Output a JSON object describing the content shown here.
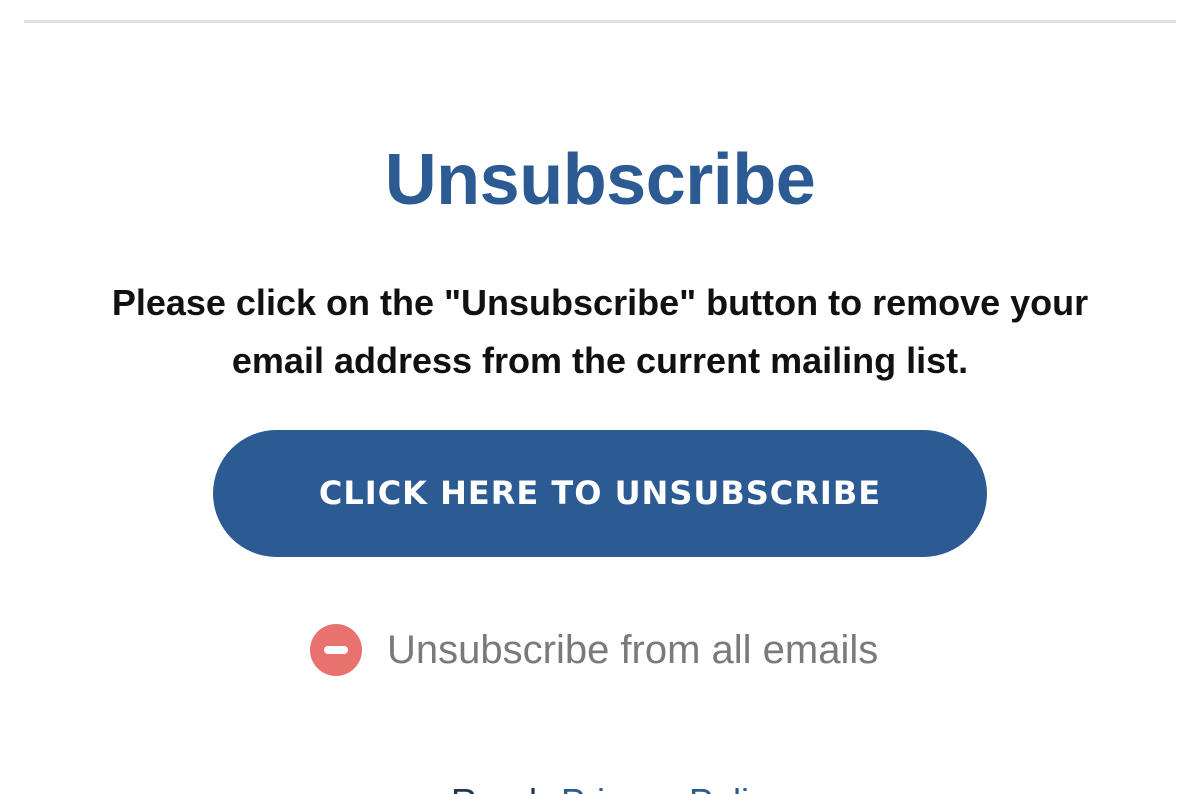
{
  "page": {
    "title": "Unsubscribe",
    "instructions_line1": "Please click on the \"Unsubscribe\" button to remove your",
    "instructions_line2": "email address from the current mailing list."
  },
  "actions": {
    "unsubscribe_button_label": "CLICK HERE TO UNSUBSCRIBE",
    "unsubscribe_all_label": "Unsubscribe from all emails",
    "unsubscribe_all_icon": "minus-circle-icon"
  },
  "footer": {
    "text_partial": "Read",
    "link_partial": "Privacy Poli"
  },
  "colors": {
    "accent": "#2c5a93",
    "remove_icon": "#e8736e",
    "secondary_text": "#7a7a7a",
    "divider": "#e2e2e2"
  }
}
